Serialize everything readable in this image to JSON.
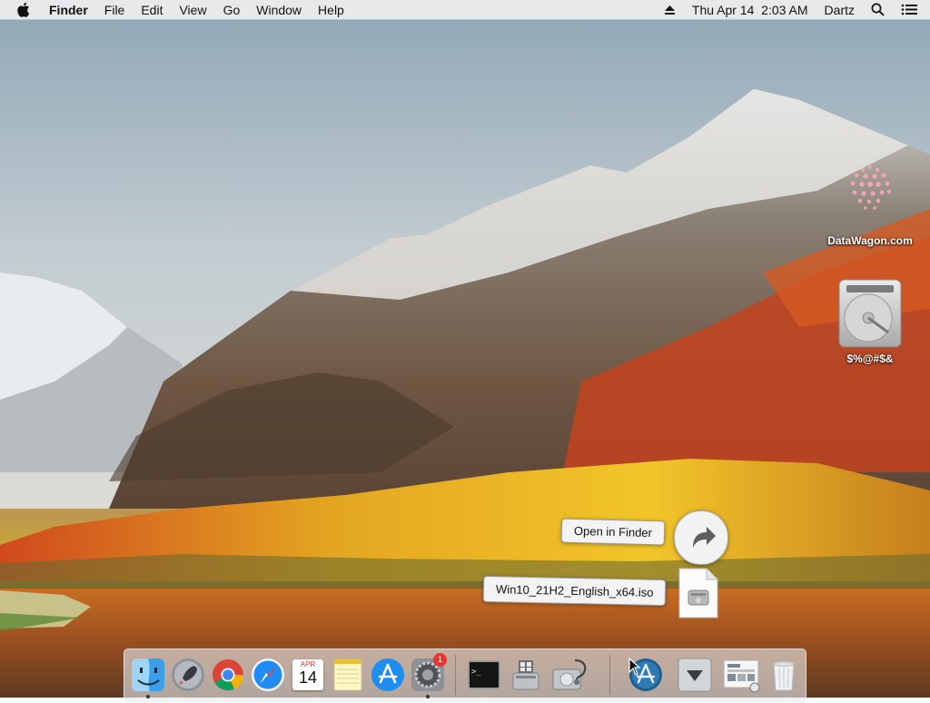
{
  "menubar": {
    "app_name": "Finder",
    "menus": [
      "File",
      "Edit",
      "View",
      "Go",
      "Window",
      "Help"
    ],
    "datetime": "Thu Apr 14  2:03 AM",
    "user": "Dartz",
    "icons": [
      "apple-icon",
      "eject-icon",
      "spotlight-search-icon",
      "notification-center-icon"
    ]
  },
  "desktop": {
    "items": [
      {
        "label": "DataWagon.com",
        "icon": "datawagon-logo-icon"
      },
      {
        "label": "$%@#$&",
        "icon": "hard-drive-icon"
      }
    ]
  },
  "drag": {
    "tooltip": "Open in Finder",
    "file_name": "Win10_21H2_English_x64.iso",
    "icons": [
      "redirect-arrow-icon",
      "disk-image-file-icon"
    ]
  },
  "dock": {
    "apps": [
      {
        "name": "finder",
        "icon": "finder-icon",
        "running": true
      },
      {
        "name": "launchpad",
        "icon": "launchpad-icon",
        "running": false
      },
      {
        "name": "chrome",
        "icon": "chrome-icon",
        "running": false
      },
      {
        "name": "safari",
        "icon": "safari-icon",
        "running": false
      },
      {
        "name": "calendar",
        "icon": "calendar-icon",
        "running": false
      },
      {
        "name": "notes",
        "icon": "notes-icon",
        "running": false
      },
      {
        "name": "app-store",
        "icon": "app-store-icon",
        "running": false
      },
      {
        "name": "system-preferences",
        "icon": "system-preferences-icon",
        "running": true,
        "badge": "1"
      },
      {
        "name": "terminal",
        "icon": "terminal-icon",
        "running": false
      },
      {
        "name": "boot-camp-assistant",
        "icon": "boot-camp-icon",
        "running": false
      },
      {
        "name": "disk-utility",
        "icon": "disk-utility-icon",
        "running": false
      },
      {
        "name": "install-macos",
        "icon": "install-macos-icon",
        "running": false
      },
      {
        "name": "downloads",
        "icon": "downloads-folder-icon",
        "running": false
      },
      {
        "name": "documents",
        "icon": "documents-stack-icon",
        "running": false
      },
      {
        "name": "trash",
        "icon": "trash-icon",
        "running": false
      }
    ],
    "calendar_month": "APR",
    "calendar_day": "14",
    "terminal_prompt": ">_"
  }
}
